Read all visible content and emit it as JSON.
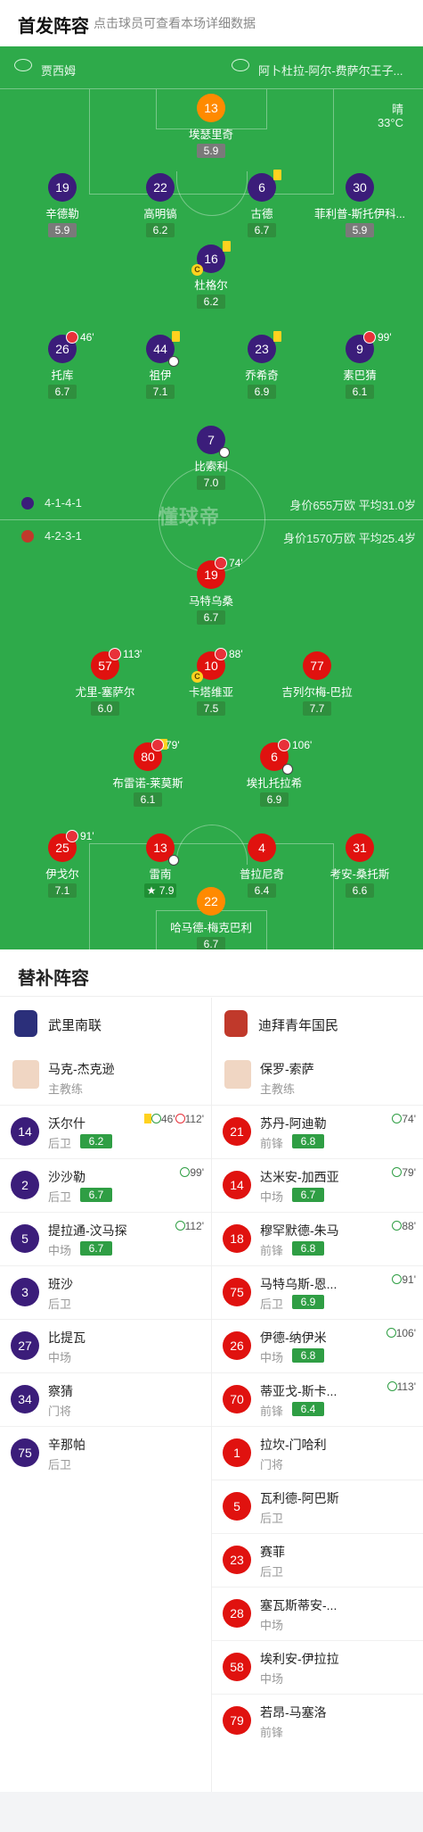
{
  "header": {
    "title": "首发阵容",
    "subtitle": "点击球员可查看本场详细数据"
  },
  "match_info": {
    "home_coach": "贾西姆",
    "away_venue": "阿卜杜拉-阿尔-费萨尔王子...",
    "weather": "晴",
    "temperature": "33°C"
  },
  "pitch": {
    "home_formation": "4-1-4-1",
    "home_value": "身价655万欧",
    "home_age": "平均31.0岁",
    "away_formation": "4-2-3-1",
    "away_value": "身价1570万欧",
    "away_age": "平均25.4岁",
    "watermark": "懂球帝"
  },
  "home_players": [
    {
      "num": "13",
      "name": "埃瑟里奇",
      "rating": "5.9",
      "gk": true,
      "low": true
    },
    {
      "num": "19",
      "name": "辛德勒",
      "rating": "5.9",
      "low": true
    },
    {
      "num": "22",
      "name": "高明镐",
      "rating": "6.2"
    },
    {
      "num": "6",
      "name": "古德",
      "rating": "6.7",
      "yellow": true
    },
    {
      "num": "30",
      "name": "菲利普-斯托伊科...",
      "rating": "5.9",
      "low": true
    },
    {
      "num": "16",
      "name": "杜格尔",
      "rating": "6.2",
      "yellow": true,
      "captain": true
    },
    {
      "num": "26",
      "name": "托库",
      "rating": "6.7",
      "sub_time": "46'"
    },
    {
      "num": "44",
      "name": "祖伊",
      "rating": "7.1",
      "yellow": true,
      "ball": true
    },
    {
      "num": "23",
      "name": "乔希奇",
      "rating": "6.9",
      "yellow": true
    },
    {
      "num": "9",
      "name": "素巴猜",
      "rating": "6.1",
      "sub_time": "99'"
    },
    {
      "num": "7",
      "name": "比索利",
      "rating": "7.0",
      "ball": true
    }
  ],
  "away_players": [
    {
      "num": "19",
      "name": "马特乌桑",
      "rating": "6.7",
      "sub_time": "74'"
    },
    {
      "num": "57",
      "name": "尤里-塞萨尔",
      "rating": "6.0",
      "sub_time": "113'"
    },
    {
      "num": "10",
      "name": "卡塔维亚",
      "rating": "7.5",
      "sub_time": "88'",
      "captain": true
    },
    {
      "num": "77",
      "name": "吉列尔梅-巴拉",
      "rating": "7.7"
    },
    {
      "num": "80",
      "name": "布雷诺-莱莫斯",
      "rating": "6.1",
      "sub_time": "79'",
      "yellow": true
    },
    {
      "num": "6",
      "name": "埃扎托拉希",
      "rating": "6.9",
      "sub_time": "106'",
      "ball": true
    },
    {
      "num": "25",
      "name": "伊戈尔",
      "rating": "7.1",
      "sub_time": "91'"
    },
    {
      "num": "13",
      "name": "雷南",
      "rating": "7.9",
      "star": true,
      "ball": true
    },
    {
      "num": "4",
      "name": "普拉尼奇",
      "rating": "6.4"
    },
    {
      "num": "31",
      "name": "考安-桑托斯",
      "rating": "6.6"
    },
    {
      "num": "22",
      "name": "哈马德-梅克巴利",
      "rating": "6.7",
      "gk": true
    }
  ],
  "bench": {
    "title": "替补阵容",
    "home_team": "武里南联",
    "away_team": "迪拜青年国民",
    "home_coach": "马克-杰克逊",
    "away_coach": "保罗-索萨",
    "coach_role": "主教练",
    "home_subs": [
      {
        "num": "14",
        "name": "沃尔什",
        "pos": "后卫",
        "rating": "6.2",
        "ev": "46'",
        "ev2": "112'",
        "yellow": true
      },
      {
        "num": "2",
        "name": "沙沙勒",
        "pos": "后卫",
        "rating": "6.7",
        "ev": "99'"
      },
      {
        "num": "5",
        "name": "提拉通-汶马探",
        "pos": "中场",
        "rating": "6.7",
        "ev": "112'"
      },
      {
        "num": "3",
        "name": "班沙",
        "pos": "后卫"
      },
      {
        "num": "27",
        "name": "比提瓦",
        "pos": "中场"
      },
      {
        "num": "34",
        "name": "察猜",
        "pos": "门将"
      },
      {
        "num": "75",
        "name": "辛那帕",
        "pos": "后卫"
      }
    ],
    "away_subs": [
      {
        "num": "21",
        "name": "苏丹-阿迪勒",
        "pos": "前锋",
        "rating": "6.8",
        "ev": "74'"
      },
      {
        "num": "14",
        "name": "达米安-加西亚",
        "pos": "中场",
        "rating": "6.7",
        "ev": "79'"
      },
      {
        "num": "18",
        "name": "穆罕默德-朱马",
        "pos": "前锋",
        "rating": "6.8",
        "ev": "88'"
      },
      {
        "num": "75",
        "name": "马特乌斯-恩...",
        "pos": "后卫",
        "rating": "6.9",
        "ev": "91'"
      },
      {
        "num": "26",
        "name": "伊德-纳伊米",
        "pos": "中场",
        "rating": "6.8",
        "ev": "106'"
      },
      {
        "num": "70",
        "name": "蒂亚戈-斯卡...",
        "pos": "前锋",
        "rating": "6.4",
        "ev": "113'"
      },
      {
        "num": "1",
        "name": "拉坎-门哈利",
        "pos": "门将"
      },
      {
        "num": "5",
        "name": "瓦利德-阿巴斯",
        "pos": "后卫"
      },
      {
        "num": "23",
        "name": "赛菲",
        "pos": "后卫"
      },
      {
        "num": "28",
        "name": "塞瓦斯蒂安-...",
        "pos": "中场"
      },
      {
        "num": "58",
        "name": "埃利安-伊拉拉",
        "pos": "中场"
      },
      {
        "num": "79",
        "name": "若昂-马塞洛",
        "pos": "前锋"
      }
    ]
  },
  "colors": {
    "pitch": "#2eaa4a",
    "home": "#3b1d7a",
    "away": "#e0120f",
    "gk": "#ff8a00",
    "rating": "#2f8f3e"
  }
}
